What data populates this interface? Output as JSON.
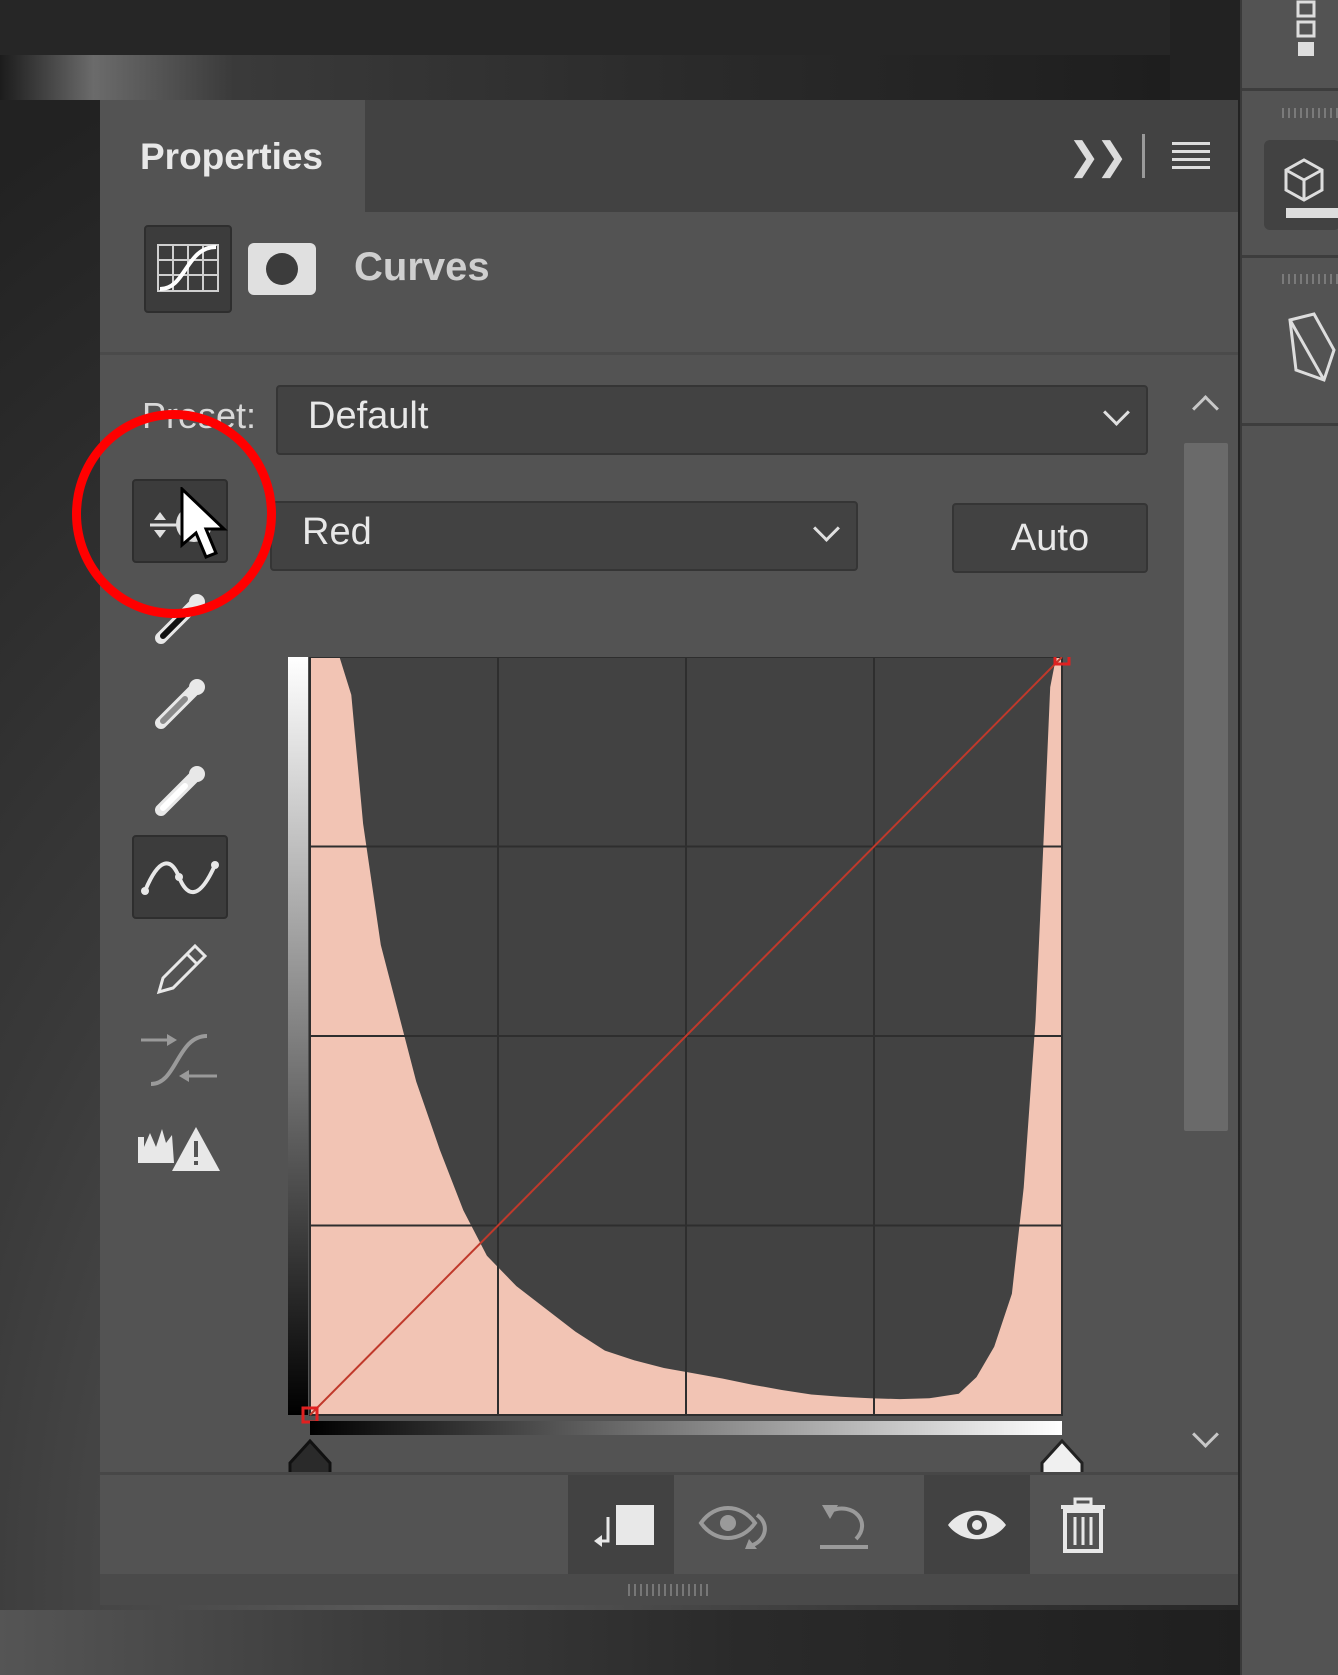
{
  "panel": {
    "tab_label": "Properties",
    "adjustment_title": "Curves"
  },
  "preset": {
    "label": "Preset:",
    "value": "Default"
  },
  "channel": {
    "value": "Red"
  },
  "auto_label": "Auto",
  "colors": {
    "panel_bg": "#535353",
    "histogram_fill": "#f2c4b4",
    "curve_line": "#c0392b",
    "highlight_circle": "#ff0000"
  },
  "curve": {
    "points": [
      [
        0,
        0
      ],
      [
        255,
        255
      ]
    ]
  },
  "histogram": {
    "levels": [
      [
        0,
        1.0
      ],
      [
        10,
        1.0
      ],
      [
        14,
        0.95
      ],
      [
        18,
        0.78
      ],
      [
        24,
        0.62
      ],
      [
        30,
        0.53
      ],
      [
        36,
        0.44
      ],
      [
        44,
        0.35
      ],
      [
        52,
        0.27
      ],
      [
        60,
        0.21
      ],
      [
        70,
        0.17
      ],
      [
        80,
        0.14
      ],
      [
        90,
        0.11
      ],
      [
        100,
        0.085
      ],
      [
        110,
        0.072
      ],
      [
        120,
        0.062
      ],
      [
        130,
        0.055
      ],
      [
        140,
        0.048
      ],
      [
        150,
        0.04
      ],
      [
        160,
        0.033
      ],
      [
        170,
        0.027
      ],
      [
        180,
        0.024
      ],
      [
        190,
        0.022
      ],
      [
        200,
        0.021
      ],
      [
        210,
        0.022
      ],
      [
        220,
        0.028
      ],
      [
        226,
        0.05
      ],
      [
        232,
        0.09
      ],
      [
        238,
        0.16
      ],
      [
        242,
        0.3
      ],
      [
        246,
        0.52
      ],
      [
        249,
        0.78
      ],
      [
        251,
        0.96
      ],
      [
        253,
        1.0
      ],
      [
        255,
        1.0
      ]
    ]
  },
  "icons": {
    "targeted_adjustment": "hand-drag-icon",
    "black_point": "eyedropper-black-icon",
    "gray_point": "eyedropper-gray-icon",
    "white_point": "eyedropper-white-icon",
    "edit_points": "curve-points-icon",
    "draw": "pencil-icon",
    "smooth": "smooth-curve-icon",
    "clipping": "clipping-warning-icon",
    "clip_to_layer": "clip-to-layer-icon",
    "view_previous": "view-previous-icon",
    "reset": "reset-icon",
    "visibility": "eye-icon",
    "delete": "trash-icon"
  }
}
